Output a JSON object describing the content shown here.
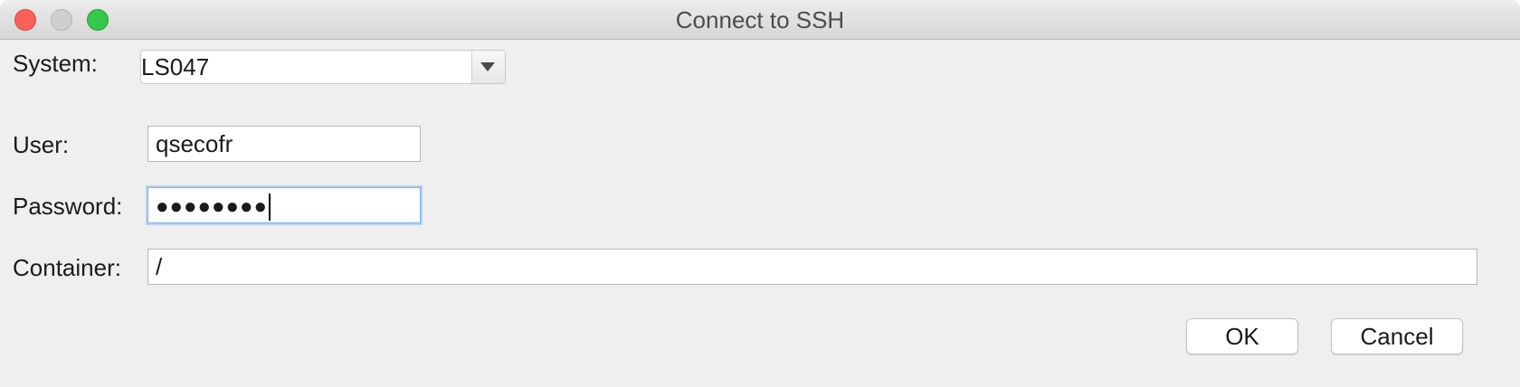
{
  "window": {
    "title": "Connect to SSH"
  },
  "form": {
    "system": {
      "label": "System:",
      "value": "LS047"
    },
    "user": {
      "label": "User:",
      "value": "qsecofr"
    },
    "password": {
      "label": "Password:",
      "masked_value": "●●●●●●●●"
    },
    "container": {
      "label": "Container:",
      "value": "/"
    }
  },
  "buttons": {
    "ok_label": "OK",
    "cancel_label": "Cancel"
  },
  "icons": {
    "close": "close-window-icon",
    "minimize": "minimize-window-icon",
    "maximize": "maximize-window-icon",
    "dropdown": "chevron-down-icon"
  },
  "colors": {
    "close": "#fc605b",
    "minimize": "#cfcfcf",
    "maximize": "#35c84a",
    "focus_ring": "#7eaee6"
  }
}
